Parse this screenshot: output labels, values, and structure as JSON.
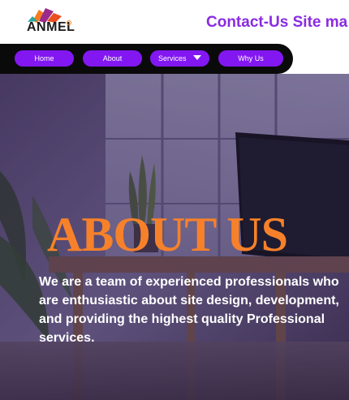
{
  "header": {
    "logo_text": "ANMEL",
    "logo_icon": "anmel-logo",
    "site_title": "Contact-Us Site ma"
  },
  "nav": {
    "items": [
      {
        "label": "Home"
      },
      {
        "label": "About"
      },
      {
        "label": "Services"
      },
      {
        "label": "Why Us"
      }
    ],
    "dropdown_icon": "caret-down-icon"
  },
  "hero": {
    "title": "ABOUT US",
    "text": "We are a team of experienced professionals who are enthusiastic about site design, development, and providing the highest quality Professional services."
  },
  "colors": {
    "title_purple": "#8a2be2",
    "nav_button": "#8317f2",
    "nav_bar": "#0a0a0a",
    "hero_title": "#f7812a",
    "hero_overlay": "#3a2a5a"
  }
}
